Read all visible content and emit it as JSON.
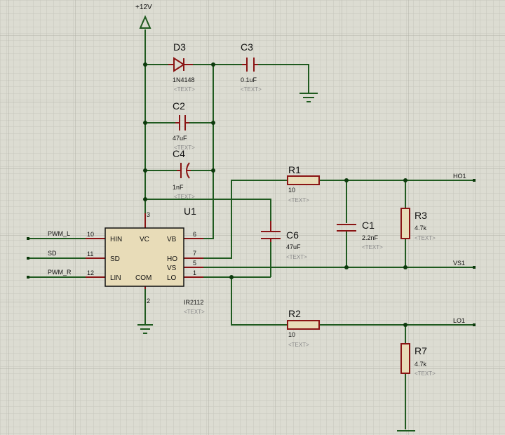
{
  "supply_label": "+12V",
  "d3": {
    "ref": "D3",
    "value": "1N4148",
    "hint": "<TEXT>"
  },
  "c3": {
    "ref": "C3",
    "value": "0.1uF",
    "hint": "<TEXT>"
  },
  "c2": {
    "ref": "C2",
    "value": "47uF",
    "hint": "<TEXT>"
  },
  "c4": {
    "ref": "C4",
    "value": "1nF",
    "hint": "<TEXT>"
  },
  "r1": {
    "ref": "R1",
    "value": "10",
    "hint": "<TEXT>"
  },
  "r2": {
    "ref": "R2",
    "value": "10",
    "hint": "<TEXT>"
  },
  "r3": {
    "ref": "R3",
    "value": "4.7k",
    "hint": "<TEXT>"
  },
  "r7": {
    "ref": "R7",
    "value": "4.7k",
    "hint": "<TEXT>"
  },
  "c1": {
    "ref": "C1",
    "value": "2.2nF",
    "hint": "<TEXT>"
  },
  "c6": {
    "ref": "C6",
    "value": "47uF",
    "hint": "<TEXT>"
  },
  "u1": {
    "ref": "U1",
    "part": "IR2112",
    "hint": "<TEXT>",
    "pins": {
      "hin": "HIN",
      "sd": "SD",
      "lin": "LIN",
      "vc": "VC",
      "com": "COM",
      "vb": "VB",
      "ho": "HO",
      "vs": "VS",
      "lo": "LO"
    },
    "pin_numbers": {
      "p10": "10",
      "p11": "11",
      "p12": "12",
      "p3": "3",
      "p2": "2",
      "p6": "6",
      "p7": "7",
      "p5": "5",
      "p1": "1"
    }
  },
  "inputs": {
    "pwm_l": "PWM_L",
    "sd": "SD",
    "pwm_r": "PWM_R"
  },
  "outputs": {
    "ho1": "HO1",
    "vs1": "VS1",
    "lo1": "LO1"
  }
}
